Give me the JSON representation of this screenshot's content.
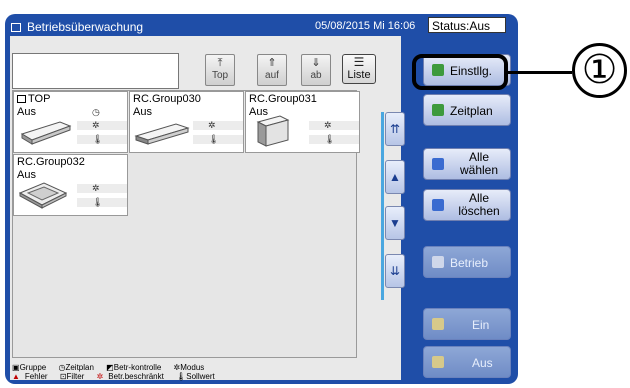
{
  "header": {
    "title": "Betriebsüberwachung",
    "datetime": "05/08/2015 Mi 16:06",
    "status": "Status:Aus"
  },
  "search": {
    "value": ""
  },
  "nav": {
    "top": "Top",
    "auf": "auf",
    "ab": "ab",
    "liste": "Liste"
  },
  "tiles": [
    {
      "name": "TOP",
      "state": "Aus",
      "has_group_icon": true
    },
    {
      "name": "RC.Group030",
      "state": "Aus"
    },
    {
      "name": "RC.Group031",
      "state": "Aus"
    },
    {
      "name": "RC.Group032",
      "state": "Aus"
    }
  ],
  "legend": {
    "gruppe": "Gruppe",
    "zeitplan": "Zeitplan",
    "betr_kontrolle": "Betr-kontrolle",
    "modus": "Modus",
    "fehler": "Fehler",
    "filter": "Filter",
    "betr_beschraenkt": "Betr.beschränkt",
    "sollwert": "Sollwert"
  },
  "buttons": {
    "einstllg": "Einstllg.",
    "zeitplan": "Zeitplan",
    "alle_waehlen_1": "Alle",
    "alle_waehlen_2": "wählen",
    "alle_loeschen_1": "Alle",
    "alle_loeschen_2": "löschen",
    "betrieb": "Betrieb",
    "ein": "Ein",
    "aus": "Aus"
  },
  "callout": {
    "number": "①"
  },
  "colors": {
    "frame": "#1f4ea8",
    "disabled_button": "#7b95cc",
    "scroll_track": "#4aa7e0"
  }
}
